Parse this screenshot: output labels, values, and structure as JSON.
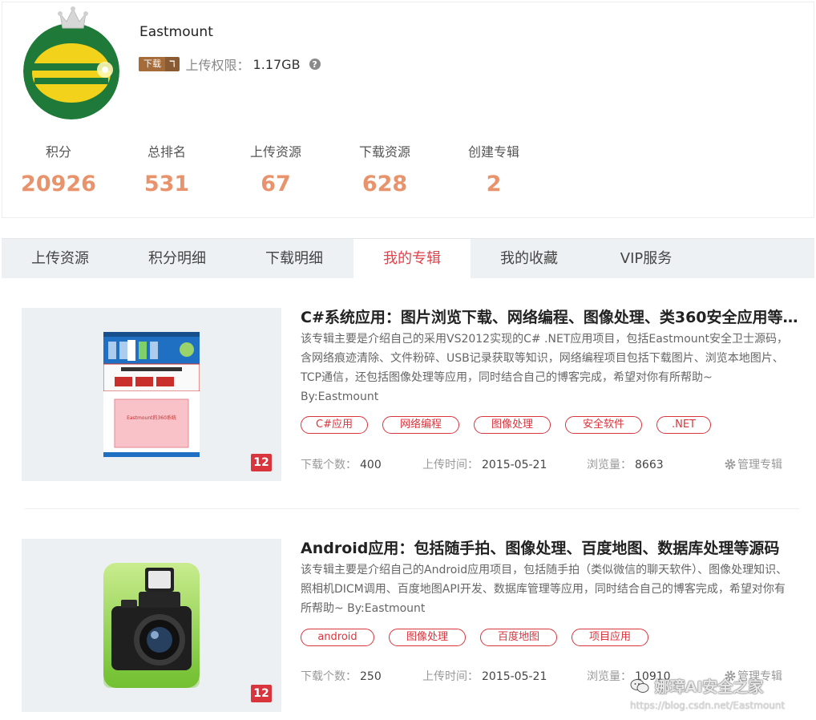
{
  "profile": {
    "username": "Eastmount",
    "download_badge": "下载",
    "download_badge_mark": "ℸ",
    "upload_permission_label": "上传权限：",
    "upload_permission_value": "1.17GB",
    "help_icon": "question-circle-icon",
    "stats": [
      {
        "label": "积分",
        "value": "20926"
      },
      {
        "label": "总排名",
        "value": "531"
      },
      {
        "label": "上传资源",
        "value": "67"
      },
      {
        "label": "下载资源",
        "value": "628"
      },
      {
        "label": "创建专辑",
        "value": "2"
      }
    ]
  },
  "tabs": [
    {
      "label": "上传资源",
      "active": false
    },
    {
      "label": "积分明细",
      "active": false
    },
    {
      "label": "下载明细",
      "active": false
    },
    {
      "label": "我的专辑",
      "active": true
    },
    {
      "label": "我的收藏",
      "active": false
    },
    {
      "label": "VIP服务",
      "active": false
    }
  ],
  "albums": [
    {
      "title": "C#系统应用：图片浏览下载、网络编程、图像处理、类360安全应用等…",
      "description": "该专辑主要是介绍自己的采用VS2012实现的C# .NET应用项目，包括Eastmount安全卫士源码，含网络痕迹清除、文件粉碎、USB记录获取等知识，网络编程项目包括下载图片、浏览本地图片、TCP通信，还包括图像处理等应用，同时结合自己的博客完成，希望对你有所帮助~",
      "author": "By:Eastmount",
      "tags": [
        "C#应用",
        "网络编程",
        "图像处理",
        "安全软件",
        ".NET"
      ],
      "count_badge": "12",
      "downloads_label": "下载个数：",
      "downloads": "400",
      "upload_time_label": "上传时间：",
      "upload_time": "2015-05-21",
      "views_label": "浏览量：",
      "views": "8663",
      "manage_label": "管理专辑",
      "thumb_caption": "Eastmount的360系统"
    },
    {
      "title": "Android应用：包括随手拍、图像处理、百度地图、数据库处理等源码",
      "description": "该专辑主要是介绍自己的Android应用项目，包括随手拍（类似微信的聊天软件）、图像处理知识、照相机DICM调用、百度地图API开发、数据库管理等应用，同时结合自己的博客完成，希望对你有所帮助~ By:Eastmount",
      "author": "",
      "tags": [
        "android",
        "图像处理",
        "百度地图",
        "项目应用"
      ],
      "count_badge": "12",
      "downloads_label": "下载个数：",
      "downloads": "250",
      "upload_time_label": "上传时间：",
      "upload_time": "2015-05-21",
      "views_label": "浏览量：",
      "views": "10910",
      "manage_label": "管理专辑",
      "thumb_caption": ""
    }
  ],
  "watermark": {
    "text": "娜璋AI安全之家",
    "url": "https://blog.csdn.net/Eastmount"
  },
  "colors": {
    "accent_red": "#d9353d",
    "stat_orange": "#e8936b",
    "tab_bg": "#eef1f3"
  }
}
